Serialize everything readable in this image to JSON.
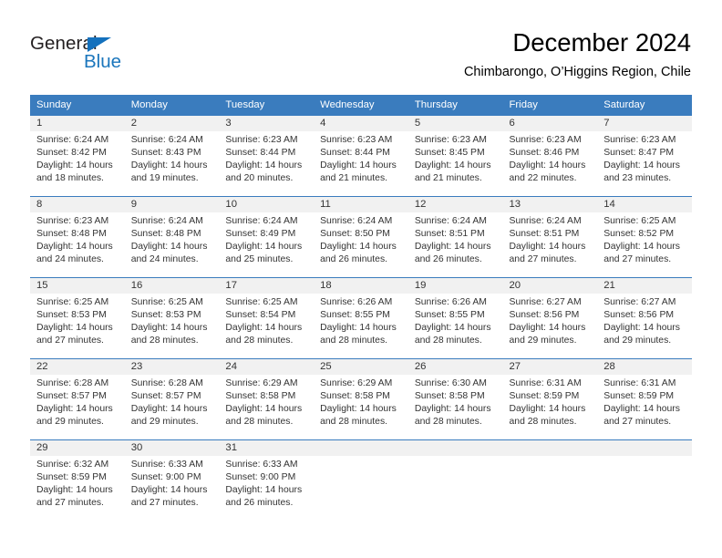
{
  "brand": {
    "name_top": "General",
    "name_bottom": "Blue",
    "color_dark": "#231f20",
    "color_blue": "#1b76bc"
  },
  "header": {
    "title": "December 2024",
    "subtitle": "Chimbarongo, O’Higgins Region, Chile"
  },
  "theme": {
    "header_bg": "#3a7cbe",
    "daynum_bg": "#f1f1f1",
    "text": "#333333"
  },
  "weekdays": [
    "Sunday",
    "Monday",
    "Tuesday",
    "Wednesday",
    "Thursday",
    "Friday",
    "Saturday"
  ],
  "weeks": [
    [
      {
        "day": "1",
        "sunrise": "Sunrise: 6:24 AM",
        "sunset": "Sunset: 8:42 PM",
        "daylight_line1": "Daylight: 14 hours",
        "daylight_line2": "and 18 minutes."
      },
      {
        "day": "2",
        "sunrise": "Sunrise: 6:24 AM",
        "sunset": "Sunset: 8:43 PM",
        "daylight_line1": "Daylight: 14 hours",
        "daylight_line2": "and 19 minutes."
      },
      {
        "day": "3",
        "sunrise": "Sunrise: 6:23 AM",
        "sunset": "Sunset: 8:44 PM",
        "daylight_line1": "Daylight: 14 hours",
        "daylight_line2": "and 20 minutes."
      },
      {
        "day": "4",
        "sunrise": "Sunrise: 6:23 AM",
        "sunset": "Sunset: 8:44 PM",
        "daylight_line1": "Daylight: 14 hours",
        "daylight_line2": "and 21 minutes."
      },
      {
        "day": "5",
        "sunrise": "Sunrise: 6:23 AM",
        "sunset": "Sunset: 8:45 PM",
        "daylight_line1": "Daylight: 14 hours",
        "daylight_line2": "and 21 minutes."
      },
      {
        "day": "6",
        "sunrise": "Sunrise: 6:23 AM",
        "sunset": "Sunset: 8:46 PM",
        "daylight_line1": "Daylight: 14 hours",
        "daylight_line2": "and 22 minutes."
      },
      {
        "day": "7",
        "sunrise": "Sunrise: 6:23 AM",
        "sunset": "Sunset: 8:47 PM",
        "daylight_line1": "Daylight: 14 hours",
        "daylight_line2": "and 23 minutes."
      }
    ],
    [
      {
        "day": "8",
        "sunrise": "Sunrise: 6:23 AM",
        "sunset": "Sunset: 8:48 PM",
        "daylight_line1": "Daylight: 14 hours",
        "daylight_line2": "and 24 minutes."
      },
      {
        "day": "9",
        "sunrise": "Sunrise: 6:24 AM",
        "sunset": "Sunset: 8:48 PM",
        "daylight_line1": "Daylight: 14 hours",
        "daylight_line2": "and 24 minutes."
      },
      {
        "day": "10",
        "sunrise": "Sunrise: 6:24 AM",
        "sunset": "Sunset: 8:49 PM",
        "daylight_line1": "Daylight: 14 hours",
        "daylight_line2": "and 25 minutes."
      },
      {
        "day": "11",
        "sunrise": "Sunrise: 6:24 AM",
        "sunset": "Sunset: 8:50 PM",
        "daylight_line1": "Daylight: 14 hours",
        "daylight_line2": "and 26 minutes."
      },
      {
        "day": "12",
        "sunrise": "Sunrise: 6:24 AM",
        "sunset": "Sunset: 8:51 PM",
        "daylight_line1": "Daylight: 14 hours",
        "daylight_line2": "and 26 minutes."
      },
      {
        "day": "13",
        "sunrise": "Sunrise: 6:24 AM",
        "sunset": "Sunset: 8:51 PM",
        "daylight_line1": "Daylight: 14 hours",
        "daylight_line2": "and 27 minutes."
      },
      {
        "day": "14",
        "sunrise": "Sunrise: 6:25 AM",
        "sunset": "Sunset: 8:52 PM",
        "daylight_line1": "Daylight: 14 hours",
        "daylight_line2": "and 27 minutes."
      }
    ],
    [
      {
        "day": "15",
        "sunrise": "Sunrise: 6:25 AM",
        "sunset": "Sunset: 8:53 PM",
        "daylight_line1": "Daylight: 14 hours",
        "daylight_line2": "and 27 minutes."
      },
      {
        "day": "16",
        "sunrise": "Sunrise: 6:25 AM",
        "sunset": "Sunset: 8:53 PM",
        "daylight_line1": "Daylight: 14 hours",
        "daylight_line2": "and 28 minutes."
      },
      {
        "day": "17",
        "sunrise": "Sunrise: 6:25 AM",
        "sunset": "Sunset: 8:54 PM",
        "daylight_line1": "Daylight: 14 hours",
        "daylight_line2": "and 28 minutes."
      },
      {
        "day": "18",
        "sunrise": "Sunrise: 6:26 AM",
        "sunset": "Sunset: 8:55 PM",
        "daylight_line1": "Daylight: 14 hours",
        "daylight_line2": "and 28 minutes."
      },
      {
        "day": "19",
        "sunrise": "Sunrise: 6:26 AM",
        "sunset": "Sunset: 8:55 PM",
        "daylight_line1": "Daylight: 14 hours",
        "daylight_line2": "and 28 minutes."
      },
      {
        "day": "20",
        "sunrise": "Sunrise: 6:27 AM",
        "sunset": "Sunset: 8:56 PM",
        "daylight_line1": "Daylight: 14 hours",
        "daylight_line2": "and 29 minutes."
      },
      {
        "day": "21",
        "sunrise": "Sunrise: 6:27 AM",
        "sunset": "Sunset: 8:56 PM",
        "daylight_line1": "Daylight: 14 hours",
        "daylight_line2": "and 29 minutes."
      }
    ],
    [
      {
        "day": "22",
        "sunrise": "Sunrise: 6:28 AM",
        "sunset": "Sunset: 8:57 PM",
        "daylight_line1": "Daylight: 14 hours",
        "daylight_line2": "and 29 minutes."
      },
      {
        "day": "23",
        "sunrise": "Sunrise: 6:28 AM",
        "sunset": "Sunset: 8:57 PM",
        "daylight_line1": "Daylight: 14 hours",
        "daylight_line2": "and 29 minutes."
      },
      {
        "day": "24",
        "sunrise": "Sunrise: 6:29 AM",
        "sunset": "Sunset: 8:58 PM",
        "daylight_line1": "Daylight: 14 hours",
        "daylight_line2": "and 28 minutes."
      },
      {
        "day": "25",
        "sunrise": "Sunrise: 6:29 AM",
        "sunset": "Sunset: 8:58 PM",
        "daylight_line1": "Daylight: 14 hours",
        "daylight_line2": "and 28 minutes."
      },
      {
        "day": "26",
        "sunrise": "Sunrise: 6:30 AM",
        "sunset": "Sunset: 8:58 PM",
        "daylight_line1": "Daylight: 14 hours",
        "daylight_line2": "and 28 minutes."
      },
      {
        "day": "27",
        "sunrise": "Sunrise: 6:31 AM",
        "sunset": "Sunset: 8:59 PM",
        "daylight_line1": "Daylight: 14 hours",
        "daylight_line2": "and 28 minutes."
      },
      {
        "day": "28",
        "sunrise": "Sunrise: 6:31 AM",
        "sunset": "Sunset: 8:59 PM",
        "daylight_line1": "Daylight: 14 hours",
        "daylight_line2": "and 27 minutes."
      }
    ],
    [
      {
        "day": "29",
        "sunrise": "Sunrise: 6:32 AM",
        "sunset": "Sunset: 8:59 PM",
        "daylight_line1": "Daylight: 14 hours",
        "daylight_line2": "and 27 minutes."
      },
      {
        "day": "30",
        "sunrise": "Sunrise: 6:33 AM",
        "sunset": "Sunset: 9:00 PM",
        "daylight_line1": "Daylight: 14 hours",
        "daylight_line2": "and 27 minutes."
      },
      {
        "day": "31",
        "sunrise": "Sunrise: 6:33 AM",
        "sunset": "Sunset: 9:00 PM",
        "daylight_line1": "Daylight: 14 hours",
        "daylight_line2": "and 26 minutes."
      },
      {
        "day": "",
        "sunrise": "",
        "sunset": "",
        "daylight_line1": "",
        "daylight_line2": ""
      },
      {
        "day": "",
        "sunrise": "",
        "sunset": "",
        "daylight_line1": "",
        "daylight_line2": ""
      },
      {
        "day": "",
        "sunrise": "",
        "sunset": "",
        "daylight_line1": "",
        "daylight_line2": ""
      },
      {
        "day": "",
        "sunrise": "",
        "sunset": "",
        "daylight_line1": "",
        "daylight_line2": ""
      }
    ]
  ]
}
